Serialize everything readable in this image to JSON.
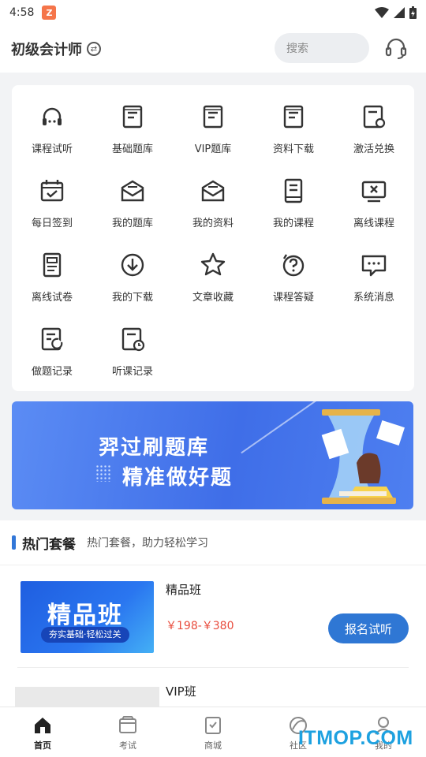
{
  "status_bar": {
    "time": "4:58",
    "app_icon": "Z"
  },
  "header": {
    "title": "初级会计师",
    "search_placeholder": "搜索"
  },
  "grid": [
    {
      "label": "课程试听",
      "icon": "headphones-icon"
    },
    {
      "label": "基础题库",
      "icon": "book-icon"
    },
    {
      "label": "VIP题库",
      "icon": "book-icon"
    },
    {
      "label": "资料下载",
      "icon": "book-icon"
    },
    {
      "label": "激活兑换",
      "icon": "activate-icon"
    },
    {
      "label": "每日签到",
      "icon": "calendar-check-icon"
    },
    {
      "label": "我的题库",
      "icon": "envelope-icon"
    },
    {
      "label": "我的资料",
      "icon": "envelope-icon"
    },
    {
      "label": "我的课程",
      "icon": "notebook-icon"
    },
    {
      "label": "离线课程",
      "icon": "monitor-x-icon"
    },
    {
      "label": "离线试卷",
      "icon": "paper-icon"
    },
    {
      "label": "我的下载",
      "icon": "download-icon"
    },
    {
      "label": "文章收藏",
      "icon": "star-icon"
    },
    {
      "label": "课程答疑",
      "icon": "question-icon"
    },
    {
      "label": "系统消息",
      "icon": "message-icon"
    },
    {
      "label": "做题记录",
      "icon": "record-icon"
    },
    {
      "label": "听课记录",
      "icon": "history-icon"
    }
  ],
  "banner": {
    "title": "羿过刷题库",
    "subtitle": "精准做好题"
  },
  "hot": {
    "title": "热门套餐",
    "subtitle": "热门套餐，助力轻松学习"
  },
  "courses": [
    {
      "name": "精品班",
      "price": "￥198-￥380",
      "thumb_title": "精品班",
      "thumb_tag": "夯实基础·轻松过关",
      "button": "报名试听"
    },
    {
      "name": "VIP班"
    }
  ],
  "tabs": [
    {
      "label": "首页",
      "icon": "home-icon",
      "active": true
    },
    {
      "label": "考试",
      "icon": "exam-icon"
    },
    {
      "label": "商城",
      "icon": "shop-icon"
    },
    {
      "label": "社区",
      "icon": "community-icon"
    },
    {
      "label": "我的",
      "icon": "user-icon"
    }
  ],
  "watermark": "ITMOP.COM"
}
